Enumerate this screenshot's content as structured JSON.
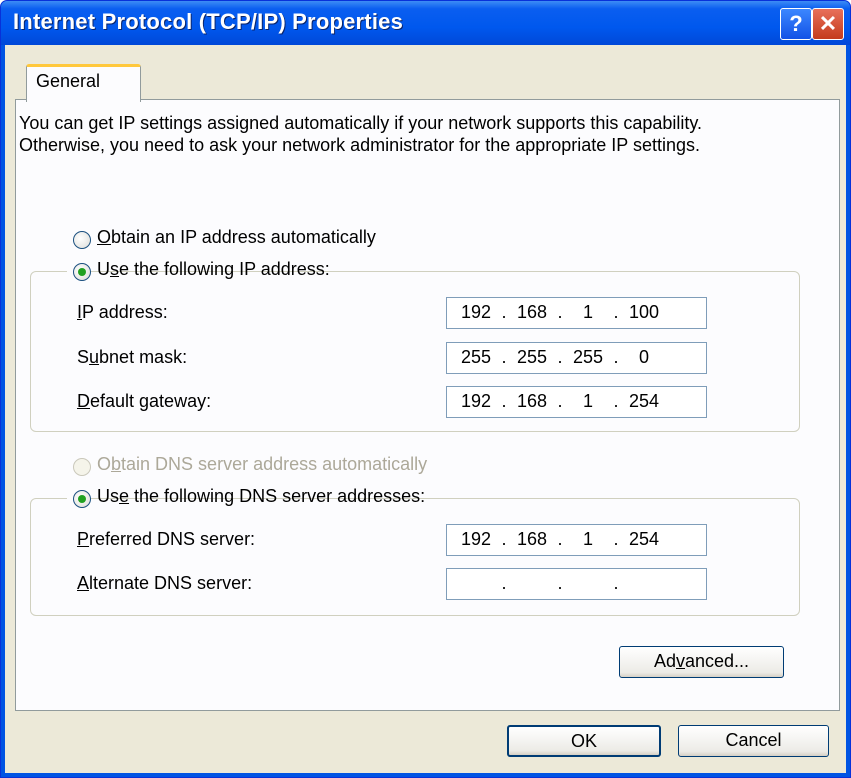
{
  "window": {
    "title": "Internet Protocol (TCP/IP) Properties",
    "help_button": "?",
    "close_button": "✕"
  },
  "tabs": [
    {
      "label": "General"
    }
  ],
  "description": "You can get IP settings assigned automatically if your network supports this capability. Otherwise, you need to ask your network administrator for the appropriate IP settings.",
  "ip_mode": {
    "auto": {
      "before": "",
      "accel": "O",
      "after": "btain an IP address automatically",
      "selected": false,
      "enabled": true
    },
    "manual": {
      "before": "U",
      "accel": "s",
      "after": "e the following IP address:",
      "selected": true,
      "enabled": true
    }
  },
  "ip_fields": [
    {
      "before": "",
      "accel": "I",
      "after": "P address:",
      "octets": [
        "192",
        "168",
        "1",
        "100"
      ]
    },
    {
      "before": "S",
      "accel": "u",
      "after": "bnet mask:",
      "octets": [
        "255",
        "255",
        "255",
        "0"
      ]
    },
    {
      "before": "",
      "accel": "D",
      "after": "efault gateway:",
      "octets": [
        "192",
        "168",
        "1",
        "254"
      ]
    }
  ],
  "dns_mode": {
    "auto": {
      "before": "O",
      "accel": "b",
      "after": "tain DNS server address automatically",
      "selected": false,
      "enabled": false
    },
    "manual": {
      "before": "Us",
      "accel": "e",
      "after": " the following DNS server addresses:",
      "selected": true,
      "enabled": true
    }
  },
  "dns_fields": [
    {
      "before": "",
      "accel": "P",
      "after": "referred DNS server:",
      "octets": [
        "192",
        "168",
        "1",
        "254"
      ]
    },
    {
      "before": "",
      "accel": "A",
      "after": "lternate DNS server:",
      "octets": [
        "",
        "",
        "",
        ""
      ]
    }
  ],
  "ip_separator": ".",
  "buttons": {
    "advanced": {
      "before": "Ad",
      "accel": "v",
      "after": "anced..."
    },
    "ok": "OK",
    "cancel": "Cancel"
  },
  "colors": {
    "titlebar": "#0058ee",
    "face": "#ece9d8",
    "panel": "#fcfcfe",
    "tab_highlight": "#ffc83c",
    "radio_dot": "#21a121",
    "disabled_text": "#aca899"
  }
}
